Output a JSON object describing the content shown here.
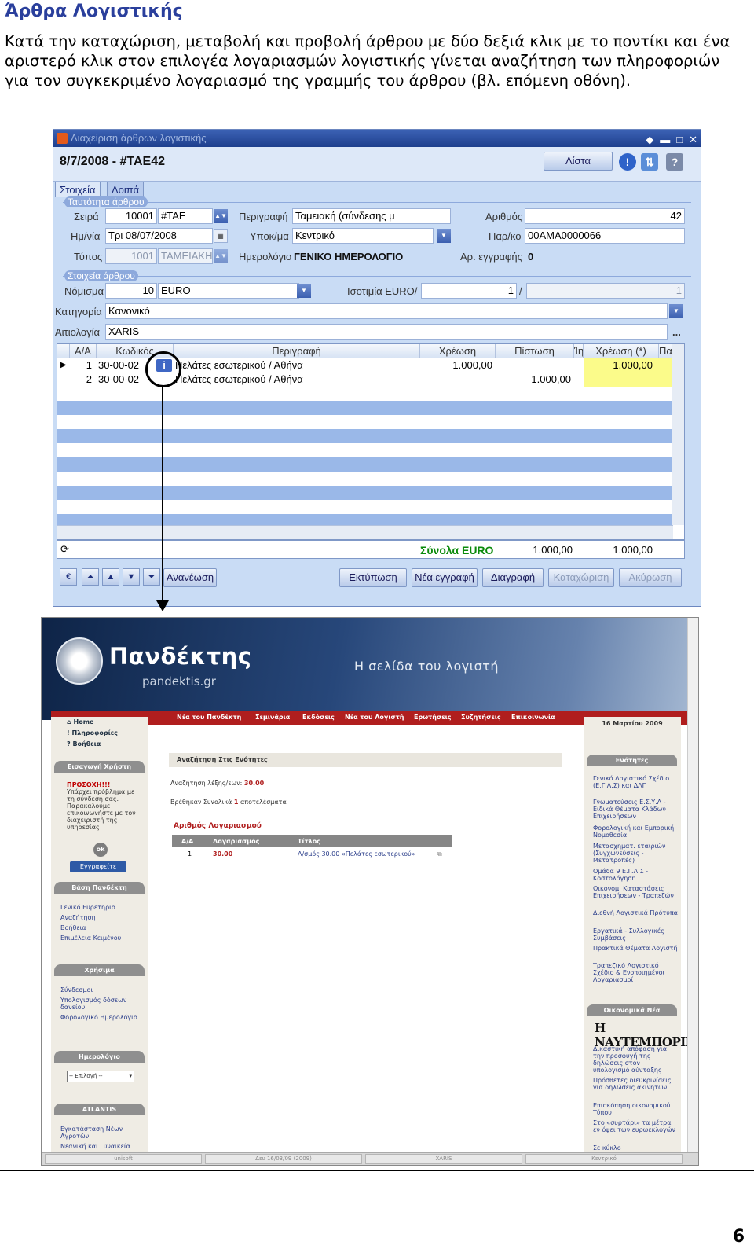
{
  "doc": {
    "heading": "Άρθρα Λογιστικής",
    "intro": "Κατά την καταχώριση, μεταβολή και προβολή άρθρου με δύο δεξιά κλικ με το ποντίκι και ένα αριστερό κλικ στον επιλογέα λογαριασμών λογιστικής γίνεται αναζήτηση των πληροφοριών για τον συγκεκριμένο λογαριασμό της γραμμής του άρθρου (βλ. επόμενη οθόνη).",
    "page_number": "6"
  },
  "window": {
    "title": "Διαχείριση άρθρων λογιστικής",
    "doc_title": "8/7/2008 - #ΤΑΕ42",
    "list_button": "Λίστα",
    "tabs": [
      "Στοιχεία",
      "Λοιπά"
    ],
    "group_identity": "Ταυτότητα άρθρου",
    "group_data": "Στοιχεία άρθρου",
    "labels": {
      "seira": "Σειρά",
      "date": "Ημ/νία",
      "type": "Τύπος",
      "description": "Περιγραφή",
      "branch": "Υποκ/μα",
      "journal": "Ημερολόγιο",
      "number": "Αριθμός",
      "parko": "Παρ/κο",
      "reg_no": "Αρ. εγγραφής",
      "currency": "Νόμισμα",
      "parity": "Ισοτιμία EURO/",
      "category": "Κατηγορία",
      "reason": "Αιτιολογία"
    },
    "values": {
      "seira_num": "10001",
      "seira_code": "#ΤΑΕ",
      "date": "Τρι 08/07/2008",
      "type_num": "1001",
      "type_name": "ΤΑΜΕΙΑΚΗ",
      "description": "Ταμειακή (σύνδεσης μ",
      "branch": "Κεντρικό",
      "journal": "ΓΕΝΙΚΟ ΗΜΕΡΟΛΟΓΙΟ",
      "number": "42",
      "parko": "00ΑΜΑ0000066",
      "reg_no": "0",
      "currency_num": "10",
      "currency": "EURO",
      "parity_a": "1",
      "parity_sep": "/",
      "parity_b": "1",
      "category": "Κανονικό",
      "reason": "XARIS"
    },
    "grid": {
      "columns": [
        "Α/Α",
        "Κωδικός",
        "Περιγραφή",
        "Χρέωση",
        "Πίστωση",
        "Ίη",
        "Χρέωση (*)",
        "Πα"
      ],
      "rows": [
        {
          "aa": "1",
          "code": "30-00-02",
          "desc": "Πελάτες εσωτερικού / Αθήνα",
          "debit": "1.000,00",
          "credit": "",
          "debit2": "1.000,00"
        },
        {
          "aa": "2",
          "code": "30-00-02",
          "desc": "Πελάτες εσωτερικού / Αθήνα",
          "debit": "",
          "credit": "1.000,00",
          "debit2": ""
        }
      ]
    },
    "totals": {
      "label": "Σύνολα EURO",
      "debit": "1.000,00",
      "credit": "1.000,00"
    },
    "buttons": {
      "refresh": "Ανανέωση",
      "print": "Εκτύπωση",
      "new": "Νέα εγγραφή",
      "delete": "Διαγραφή",
      "save": "Καταχώριση",
      "cancel": "Ακύρωση"
    }
  },
  "site": {
    "logo": "Πανδέκτης",
    "logo_sub": "pandektis.gr",
    "tagline": "Η σελίδα του λογιστή",
    "nav": [
      "Νέα του Πανδέκτη",
      "Σεμινάρια",
      "Εκδόσεις",
      "Νέα του Λογιστή",
      "Ερωτήσεις",
      "Συζητήσεις",
      "Επικοινωνία"
    ],
    "date": "16 Μαρτίου 2009",
    "top_links": [
      "Home",
      "Πληροφορίες",
      "Βοήθεια"
    ],
    "login_header": "Εισαγωγή Χρήστη",
    "warn_title": "ΠΡΟΣΟΧΗ!!!",
    "warn_text": "Υπάρχει πρόβλημα με τη σύνδεση σας. Παρακαλούμε επικοινωνήστε με τον διαχειριστή της υπηρεσίας",
    "ok": "ok",
    "register": "Εγγραφείτε",
    "base_header": "Βάση Πανδέκτη",
    "base_links": [
      "Γενικό Ευρετήριο",
      "Αναζήτηση",
      "Βοήθεια",
      "Επιμέλεια Κειμένου"
    ],
    "tools_header": "Χρήσιμα",
    "tools_links": [
      "Σύνδεσμοι",
      "Υπολογισμός δόσεων δανείου",
      "Φορολογικό Ημερολόγιο"
    ],
    "cal_header": "Ημερολόγιο",
    "cal_select": "-- Επιλογή --",
    "atlantis_header": "ATLANTIS",
    "atlantis_links": [
      "Εγκατάσταση Νέων Αγροτών",
      "Νεανική και Γυναικεία"
    ],
    "units_header": "Ενότητες",
    "units_links": [
      "Γενικό Λογιστικό Σχέδιο (Ε.Γ.Λ.Σ) και ΔΛΠ",
      "Γνωματεύσεις Ε.Σ.Υ.Λ - Ειδικά Θέματα Κλάδων Επιχειρήσεων",
      "Φορολογική και Εμπορική Νομοθεσία",
      "Μετασχηματ. εταιριών (Συγχωνεύσεις - Μετατροπές)",
      "Ομάδα 9 Ε.Γ.Λ.Σ - Κοστολόγηση",
      "Οικονομ. Καταστάσεις Επιχειρήσεων - Τραπεζών",
      "Διεθνή Λογιστικά Πρότυπα",
      "Εργατικά - Συλλογικές Συμβάσεις",
      "Πρακτικά Θέματα Λογιστή",
      "Τραπεζικό Λογιστικό Σχέδιο & Ενοποιημένοι Λογαριασμοί"
    ],
    "econ_header": "Οικονομικά Νέα",
    "econ_logo": "Η ΝΑΥΤΕΜΠΟΡΙΚΗ",
    "econ_links": [
      "Δικαστική απόφαση για την προσφυγή της δηλώσεις στον υπολογισμό αύνταξης",
      "Πρόσθετες διευκρινίσεις για δηλώσεις ακινήτων",
      "Επισκόπηση οικονομικού Τύπου",
      "Στο «συρτάρι» τα μέτρα εν όψει των ευρωεκλογών",
      "Σε κύκλο"
    ],
    "main_title": "Αναζήτηση Στις Ενότητες",
    "search_label": "Αναζήτηση λέξης/εων:",
    "search_value": "30.00",
    "found_pre": "Βρέθηκαν Συνολικά",
    "found_num": "1",
    "found_post": "αποτελέσματα",
    "acc_title": "Αριθμός Λογαριασμού",
    "acc_cols": [
      "Α/Α",
      "Λογαριασμός",
      "Τίτλος"
    ],
    "acc_row": {
      "aa": "1",
      "account": "30.00",
      "title": "Λ/σμός 30.00 «Πελάτες εσωτερικού»"
    },
    "status": [
      "unisoft",
      "Δευ 16/03/09 (2009)",
      "XARIS",
      "Κεντρικό"
    ]
  }
}
